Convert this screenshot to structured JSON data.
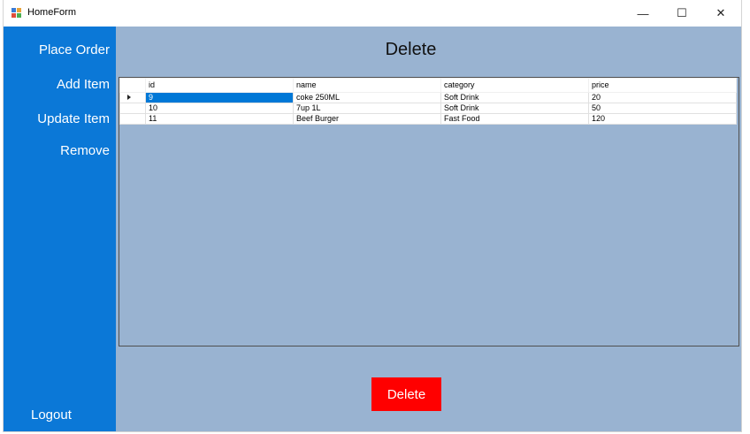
{
  "window": {
    "title": "HomeForm",
    "minimize_glyph": "—",
    "maximize_glyph": "☐",
    "close_glyph": "✕"
  },
  "sidebar": {
    "items": [
      {
        "label": "Place Order"
      },
      {
        "label": "Add Item"
      },
      {
        "label": "Update Item"
      },
      {
        "label": "Remove"
      }
    ],
    "logout_label": "Logout",
    "color": "#0b78d7"
  },
  "main": {
    "heading": "Delete",
    "background": "#99b3d1",
    "delete_button_label": "Delete",
    "delete_button_color": "#ff0000"
  },
  "grid": {
    "columns": [
      "id",
      "name",
      "category",
      "price"
    ],
    "rows": [
      {
        "id": "9",
        "name": "coke 250ML",
        "category": "Soft Drink",
        "price": "20",
        "current": true
      },
      {
        "id": "10",
        "name": "7up 1L",
        "category": "Soft Drink",
        "price": "50",
        "current": false
      },
      {
        "id": "11",
        "name": "Beef Burger",
        "category": "Fast Food",
        "price": "120",
        "current": false
      }
    ],
    "selection_color": "#0078d7"
  }
}
